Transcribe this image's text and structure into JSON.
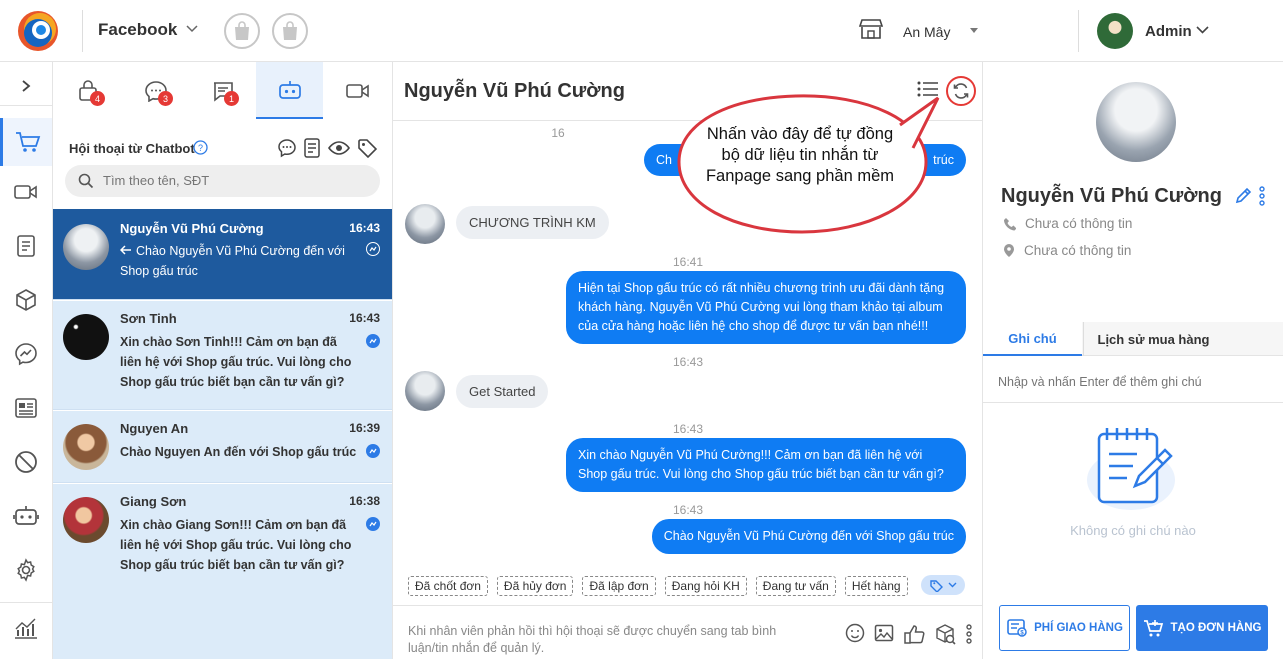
{
  "topbar": {
    "brand": "Facebook",
    "store": "An Mây",
    "user": "Admin"
  },
  "conversation_panel": {
    "tabs": [
      {
        "name": "tab-locked-chat",
        "badge": "4"
      },
      {
        "name": "tab-comments",
        "badge": "3"
      },
      {
        "name": "tab-messages",
        "badge": "1"
      },
      {
        "name": "tab-chatbot",
        "badge": ""
      },
      {
        "name": "tab-video",
        "badge": ""
      }
    ],
    "section_title": "Hội thoại từ Chatbot",
    "search_placeholder": "Tìm theo tên, SĐT",
    "conversations": [
      {
        "name": "Nguyễn Vũ Phú Cường",
        "time": "16:43",
        "message": "Chào Nguyễn Vũ Phú Cường đến với Shop gấu trúc"
      },
      {
        "name": "Sơn Tinh",
        "time": "16:43",
        "message": "Xin chào Sơn Tinh!!! Cảm ơn bạn đã liên hệ với Shop gấu trúc. Vui lòng cho Shop gấu trúc biết bạn cần tư vấn gì?"
      },
      {
        "name": "Nguyen An",
        "time": "16:39",
        "message": "Chào Nguyen An đến với Shop gấu trúc"
      },
      {
        "name": "Giang Sơn",
        "time": "16:38",
        "message": "Xin chào Giang Sơn!!! Cảm ơn bạn đã liên hệ với Shop gấu trúc. Vui lòng cho Shop gấu trúc biết bạn cần tư vấn gì?"
      }
    ]
  },
  "chat": {
    "title": "Nguyễn Vũ Phú Cường",
    "partial_time": "16",
    "partial_out_left": "Ch",
    "partial_out_right": "trúc",
    "messages": [
      {
        "text": "CHƯƠNG TRÌNH KM"
      },
      {
        "time": "16:41",
        "text": "Hiện tại Shop gấu trúc có rất nhiều chương trình ưu đãi dành tặng khách hàng. Nguyễn Vũ Phú Cường vui lòng tham khảo tại album của cửa hàng hoặc liên hệ cho shop để được tư vấn bạn nhé!!!"
      },
      {
        "time": "16:43",
        "text": "Get Started"
      },
      {
        "time": "16:43",
        "text": "Xin chào Nguyễn Vũ Phú Cường!!! Cảm ơn bạn đã liên hệ với Shop gấu trúc. Vui lòng cho Shop gấu trúc biết bạn cần tư vấn gì?"
      },
      {
        "time": "16:43",
        "text": "Chào Nguyễn Vũ Phú Cường đến với Shop gấu trúc"
      }
    ],
    "tags": [
      "Đã chốt đơn",
      "Đã hủy đơn",
      "Đã lập đơn",
      "Đang hỏi KH",
      "Đang tư vấn",
      "Hết hàng"
    ],
    "composer_placeholder": "Khi nhân viên phản hồi thì hội thoại sẽ được chuyển sang tab bình luận/tin nhắn để quản lý."
  },
  "callout": {
    "text": "Nhấn vào đây để tự đồng bộ dữ liệu tin nhắn từ Fanpage sang phần mềm"
  },
  "profile": {
    "name": "Nguyễn Vũ Phú Cường",
    "phone": "Chưa có thông tin",
    "address": "Chưa có thông tin",
    "tabs": [
      "Ghi chú",
      "Lịch sử mua hàng"
    ],
    "note_placeholder": "Nhập và nhấn Enter để thêm ghi chú",
    "empty_notes": "Không có ghi chú nào",
    "shipping_button": "PHÍ GIAO HÀNG",
    "create_order_button": "TẠO ĐƠN HÀNG"
  },
  "colors": {
    "accent": "#2d7be6",
    "bubble": "#0f7cf3",
    "active_conv": "#1e5a9e",
    "badge": "#e53935"
  }
}
